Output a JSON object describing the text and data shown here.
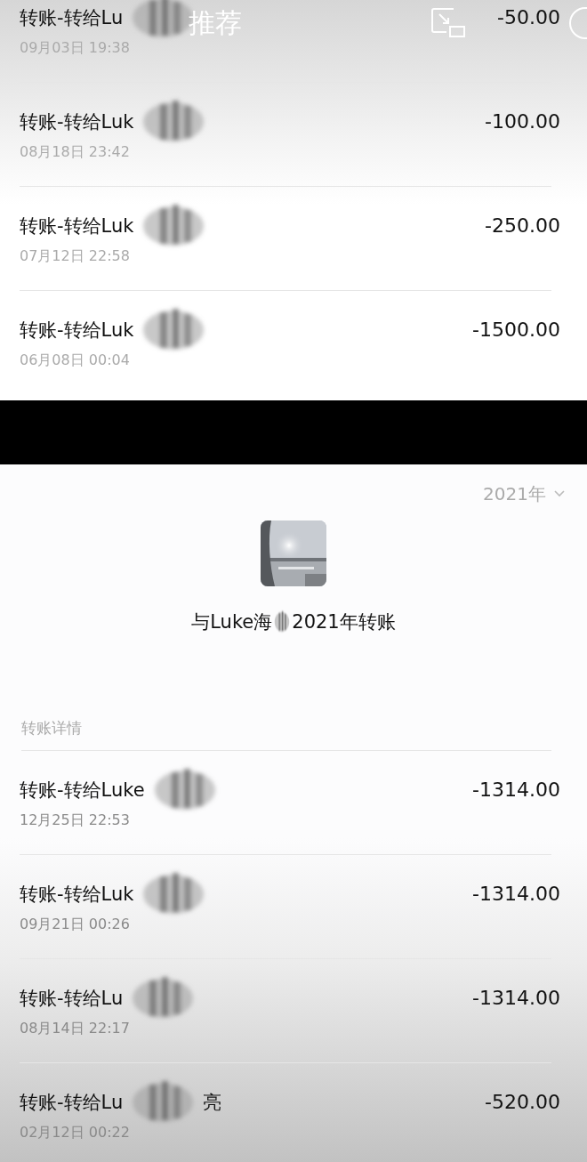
{
  "overlay": {
    "title": "推荐"
  },
  "top_list": [
    {
      "title": "转账-转给Lu",
      "redacted": true,
      "amount": "-50.00",
      "date": "09月03日 19:38"
    },
    {
      "title": "转账-转给Luk",
      "redacted": true,
      "amount": "-100.00",
      "date": "08月18日 23:42"
    },
    {
      "title": "转账-转给Luk",
      "redacted": true,
      "amount": "-250.00",
      "date": "07月12日 22:58"
    },
    {
      "title": "转账-转给Luk",
      "redacted": true,
      "amount": "-1500.00",
      "date": "06月08日 00:04"
    }
  ],
  "year_filter": {
    "label": "2021年"
  },
  "summary": {
    "name_start": "与Luke海",
    "name_redacted": true,
    "name_end": "2021年转账"
  },
  "section_title": "转账详情",
  "bottom_list": [
    {
      "title": "转账-转给Luke",
      "redacted": true,
      "amount": "-1314.00",
      "date": "12月25日 22:53"
    },
    {
      "title": "转账-转给Luk",
      "redacted": true,
      "amount": "-1314.00",
      "date": "09月21日 00:26"
    },
    {
      "title": "转账-转给Lu",
      "redacted": true,
      "amount": "-1314.00",
      "date": "08月14日 22:17"
    },
    {
      "title": "转账-转给Lu",
      "redacted": true,
      "suffix": "亮",
      "amount": "-520.00",
      "date": "02月12日 00:22"
    }
  ]
}
